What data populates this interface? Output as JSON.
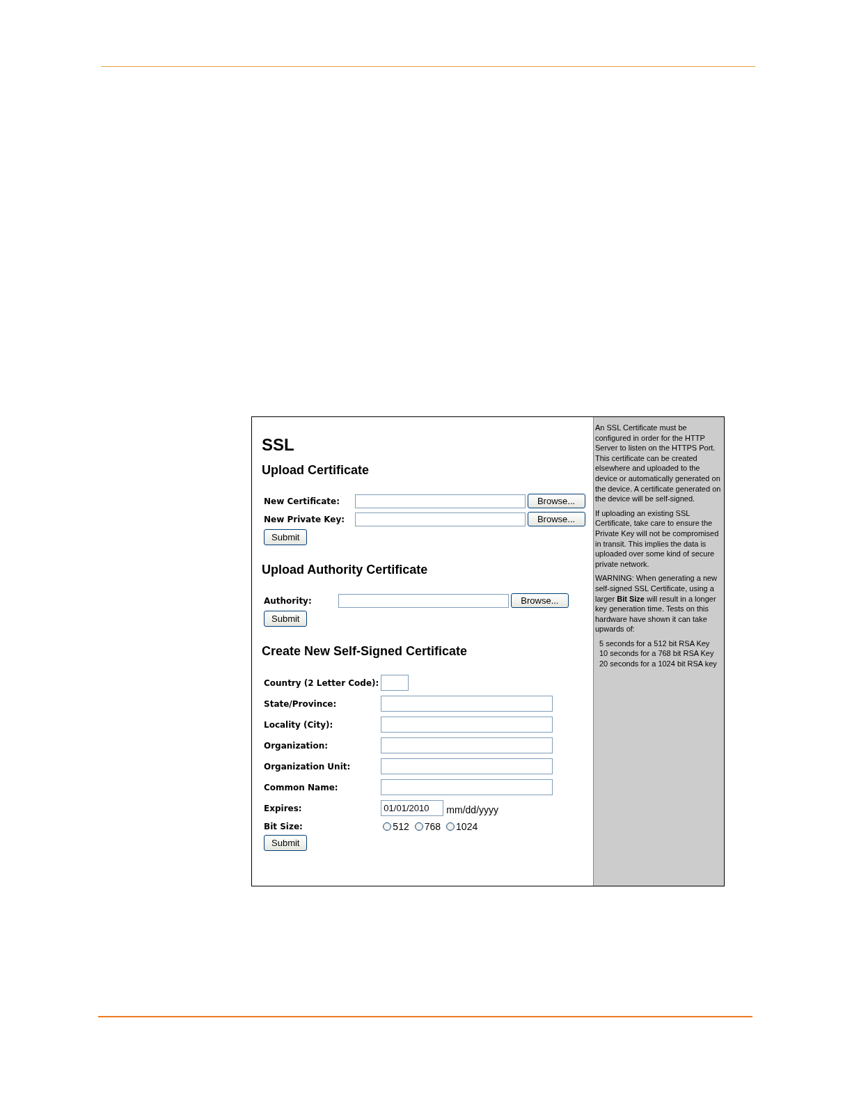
{
  "title": "SSL",
  "upload_certificate": {
    "heading": "Upload Certificate",
    "fields": [
      {
        "label": "New Certificate:",
        "button": "Browse..."
      },
      {
        "label": "New Private Key:",
        "button": "Browse..."
      }
    ],
    "submit": "Submit"
  },
  "upload_authority": {
    "heading": "Upload Authority Certificate",
    "fields": [
      {
        "label": "Authority:",
        "button": "Browse..."
      }
    ],
    "submit": "Submit"
  },
  "create_certificate": {
    "heading": "Create New Self-Signed Certificate",
    "fields": [
      {
        "kind": "short",
        "label": "Country (2 Letter Code):"
      },
      {
        "kind": "text",
        "label": "State/Province:"
      },
      {
        "kind": "text",
        "label": "Locality (City):"
      },
      {
        "kind": "text",
        "label": "Organization:"
      },
      {
        "kind": "text",
        "label": "Organization Unit:"
      },
      {
        "kind": "text",
        "label": "Common Name:"
      },
      {
        "kind": "date",
        "label": "Expires:",
        "value": "01/01/2010",
        "hint": "mm/dd/yyyy"
      },
      {
        "kind": "radio",
        "label": "Bit Size:",
        "options": [
          {
            "label": "512",
            "selected": false
          },
          {
            "label": "768",
            "selected": false
          },
          {
            "label": "1024",
            "selected": false
          }
        ]
      }
    ],
    "submit": "Submit"
  },
  "help": {
    "paragraphs": [
      "An SSL Certificate must be configured in order for the HTTP Server to listen on the HTTPS Port. This certificate can be created elsewhere and uploaded to the device or automatically generated on the device. A certificate generated on the device will be self-signed.",
      "If uploading an existing SSL Certificate, take care to ensure the Private Key will not be compromised in transit. This implies the data is uploaded over some kind of secure private network.",
      "WARNING: When generating a new self-signed SSL Certificate, using a larger **Bit Size** will result in a longer key generation time. Tests on this hardware have shown it can take upwards of:"
    ],
    "timings": [
      "5 seconds for a 512 bit RSA Key",
      "10 seconds for a 768 bit RSA Key",
      "20 seconds for a 1024 bit RSA key"
    ]
  }
}
